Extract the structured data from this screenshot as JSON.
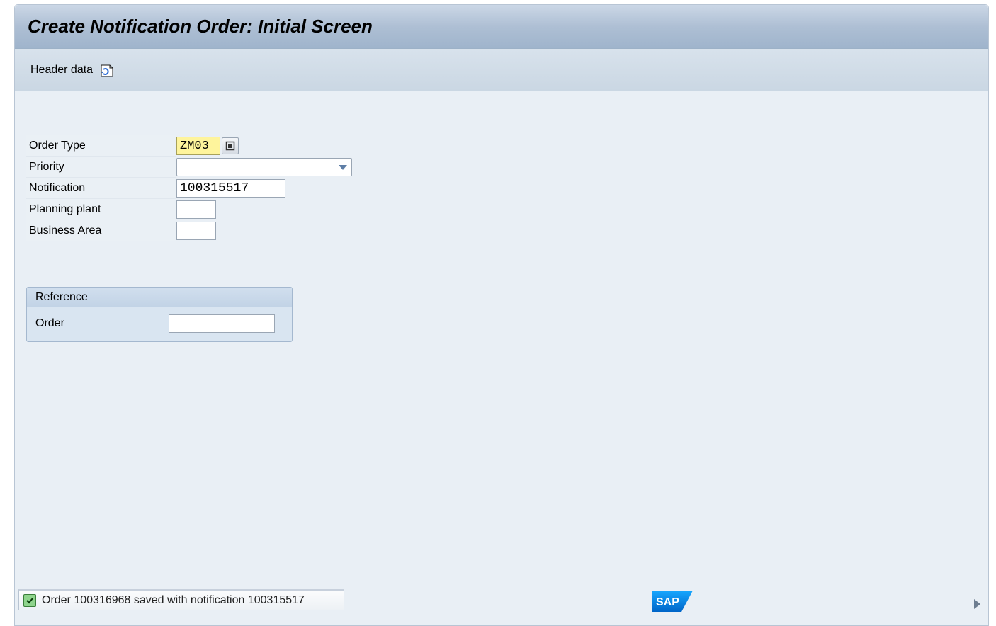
{
  "title": "Create Notification Order: Initial Screen",
  "toolbar": {
    "header_data_label": "Header data"
  },
  "form": {
    "labels": {
      "order_type": "Order Type",
      "priority": "Priority",
      "notification": "Notification",
      "planning_plant": "Planning plant",
      "business_area": "Business Area"
    },
    "values": {
      "order_type": "ZM03",
      "priority": "",
      "notification": "100315517",
      "planning_plant": "",
      "business_area": ""
    }
  },
  "reference": {
    "header": "Reference",
    "order_label": "Order",
    "order_value": ""
  },
  "status": {
    "message": "Order 100316968 saved with notification 100315517"
  },
  "branding": {
    "logo_text": "SAP"
  },
  "colors": {
    "required_bg": "#fef49c",
    "panel_bg": "#e9eff5",
    "header_grad_top": "#cbd7e6",
    "header_grad_bottom": "#9fb4cc"
  }
}
